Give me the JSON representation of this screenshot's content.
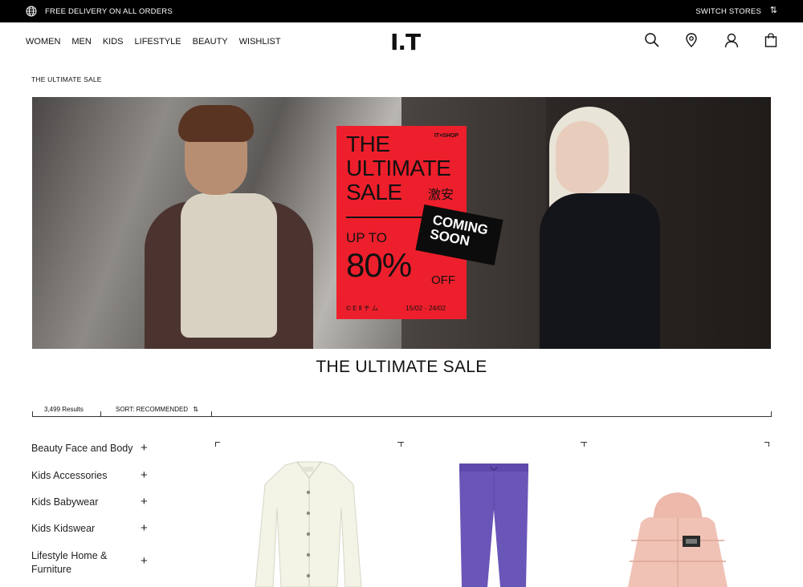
{
  "topbar": {
    "promo": "FREE DELIVERY ON ALL ORDERS",
    "switch_stores": "SWITCH STORES",
    "globe_icon": "globe-icon",
    "switch_icon": "swap-icon"
  },
  "header": {
    "logo": "I.T",
    "nav": [
      "WOMEN",
      "MEN",
      "KIDS",
      "LIFESTYLE",
      "BEAUTY",
      "WISHLIST"
    ],
    "icons": [
      "search-icon",
      "location-pin-icon",
      "user-icon",
      "shopping-bag-icon"
    ]
  },
  "breadcrumb": "THE ULTIMATE SALE",
  "banner": {
    "brand": "IT×SHOP",
    "headline": [
      "THE",
      "ULTIMATE",
      "SALE"
    ],
    "headline_cjk": "激安",
    "up_to": "UP TO",
    "percent": "80%",
    "off": "OFF",
    "footer_left": "© E Ⅱ チ ム",
    "dates": "15/02 - 24/02",
    "coming_soon": [
      "COMING",
      "SOON"
    ],
    "poster_color": "#ee1f2c"
  },
  "page_title": "THE ULTIMATE SALE",
  "toolbar": {
    "results": "3,499 Results",
    "sort": "SORT: RECOMMENDED",
    "sort_icon": "swap-icon"
  },
  "sidebar": {
    "categories": [
      "Beauty Face and Body",
      "Kids Accessories",
      "Kids Babywear",
      "Kids Kidswear",
      "Lifestyle Home & Furniture"
    ],
    "expand_icon": "plus-icon"
  },
  "products": [
    {
      "name": "cream-shirt",
      "color": "#f3f3e6"
    },
    {
      "name": "purple-sweatpants",
      "color": "#6a55b8"
    },
    {
      "name": "pink-puffer-vest",
      "color": "#f0c2b5"
    }
  ]
}
